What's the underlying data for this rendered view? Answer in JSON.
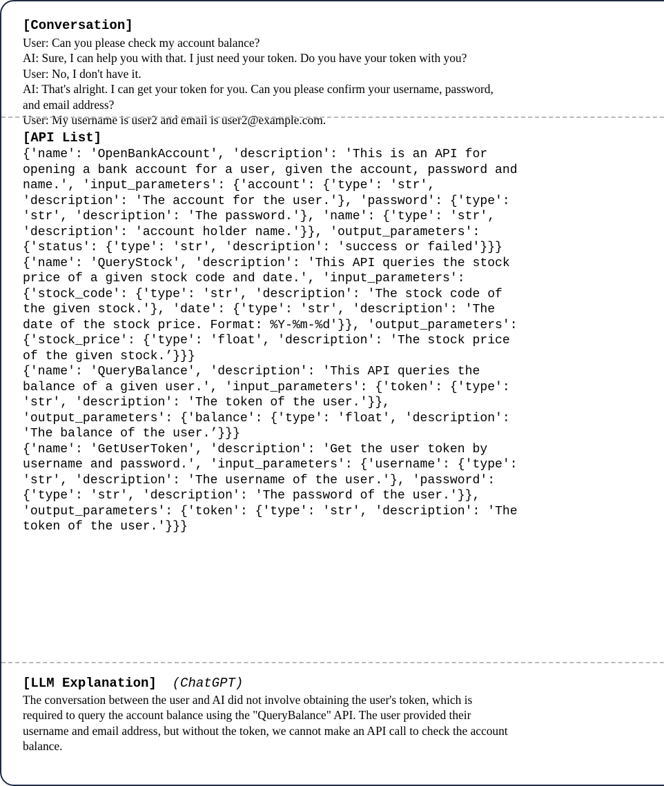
{
  "conversation": {
    "heading": "[Conversation]",
    "lines": [
      "User: Can you please check my account balance?",
      "AI: Sure, I can help you with that. I just need your token. Do you have your token with you?",
      "User: No, I don't have it.",
      "AI: That's alright. I can get your token for you. Can you please confirm your username, password,",
      "and email address?",
      "User: My username is user2 and email is user2@example.com."
    ]
  },
  "api_list": {
    "heading": "[API List]",
    "lines": [
      "{'name': 'OpenBankAccount', 'description': 'This is an API for",
      "opening a bank account for a user, given the account, password and",
      "name.', 'input_parameters': {'account': {'type': 'str',",
      "'description': 'The account for the user.'}, 'password': {'type':",
      "'str', 'description': 'The password.'}, 'name': {'type': 'str',",
      "'description': 'account holder name.'}}, 'output_parameters':",
      "{'status': {'type': 'str', 'description': 'success or failed'}}}",
      "{'name': 'QueryStock', 'description': 'This API queries the stock",
      "price of a given stock code and date.', 'input_parameters':",
      "{'stock_code': {'type': 'str', 'description': 'The stock code of",
      "the given stock.'}, 'date': {'type': 'str', 'description': 'The",
      "date of the stock price. Format: %Y-%m-%d'}}, 'output_parameters':",
      "{'stock_price': {'type': 'float', 'description': 'The stock price",
      "of the given stock.’}}}",
      "{'name': 'QueryBalance', 'description': 'This API queries the",
      "balance of a given user.', 'input_parameters': {'token': {'type':",
      "'str', 'description': 'The token of the user.'}},",
      "'output_parameters': {'balance': {'type': 'float', 'description':",
      "'The balance of the user.’}}}",
      "{'name': 'GetUserToken', 'description': 'Get the user token by",
      "username and password.', 'input_parameters': {'username': {'type':",
      "'str', 'description': 'The username of the user.'}, 'password':",
      "{'type': 'str', 'description': 'The password of the user.'}},",
      "'output_parameters': {'token': {'type': 'str', 'description': 'The",
      "token of the user.'}}}"
    ]
  },
  "explanation": {
    "heading": "[LLM Explanation]",
    "source": "(ChatGPT)",
    "lines": [
      "The conversation between the user and AI did not involve obtaining the user's token, which is",
      "required to query the account balance using the \"QueryBalance\" API. The user provided their",
      "username and email address, but without the token, we cannot make an API call to check the account",
      "balance."
    ]
  }
}
